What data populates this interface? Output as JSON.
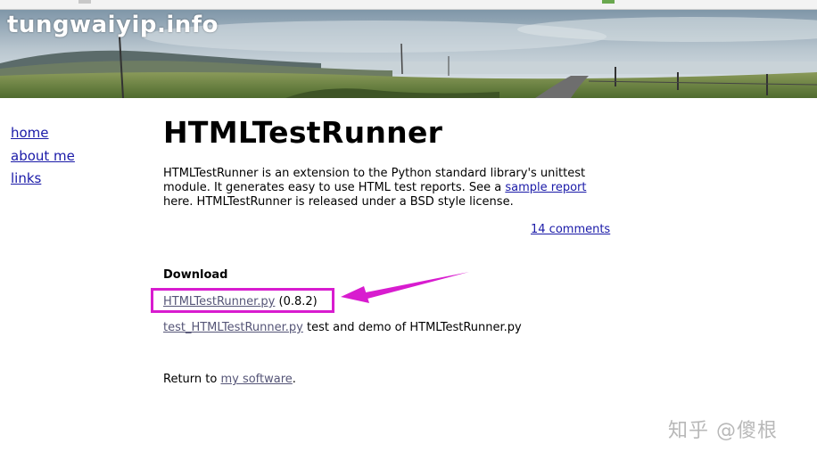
{
  "site": {
    "title": "tungwaiyip.info"
  },
  "nav": {
    "items": [
      {
        "label": "home"
      },
      {
        "label": "about me"
      },
      {
        "label": "links"
      }
    ]
  },
  "page": {
    "title": "HTMLTestRunner",
    "intro_before": "HTMLTestRunner is an extension to the Python standard library's unittest module. It generates easy to use HTML test reports. See a ",
    "intro_link": "sample report",
    "intro_after": " here. HTMLTestRunner is released under a BSD style license.",
    "comments_link": "14 comments"
  },
  "download": {
    "heading": "Download",
    "file1_link": "HTMLTestRunner.py",
    "file1_version": "(0.8.2)",
    "file2_link": "test_HTMLTestRunner.py",
    "file2_desc": "test and demo of HTMLTestRunner.py"
  },
  "footer": {
    "return_prefix": "Return to ",
    "return_link": "my software",
    "return_suffix": "."
  },
  "watermark": {
    "text": "知乎 @傻根"
  },
  "colors": {
    "link": "#1a1aa8",
    "visited_link": "#555577",
    "highlight": "#d81ccf"
  }
}
